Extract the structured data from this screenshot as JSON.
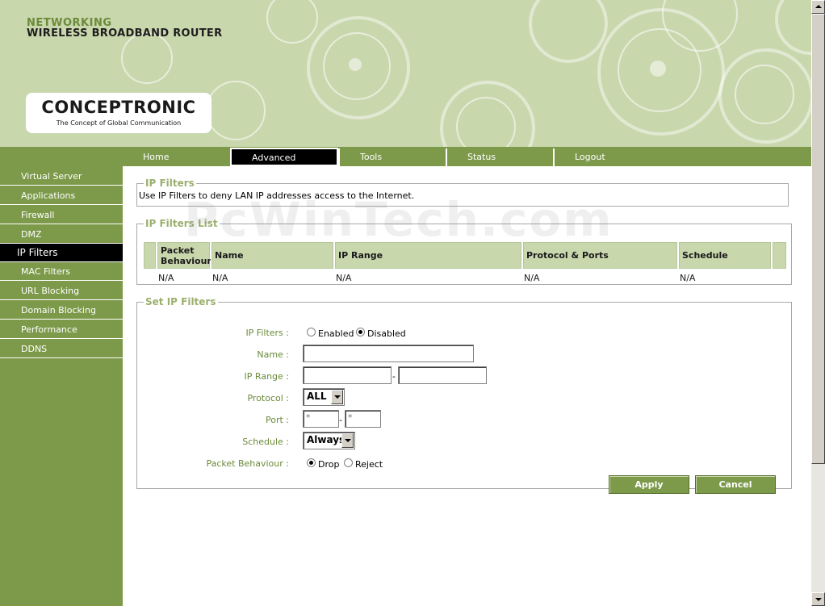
{
  "header": {
    "brand_line1": "NETWORKING",
    "brand_line2": "WIRELESS BROADBAND ROUTER",
    "logo_text": "CONCEPTRONIC",
    "logo_tagline": "The Concept of Global Communication"
  },
  "nav": {
    "tabs": [
      "Home",
      "Advanced",
      "Tools",
      "Status",
      "Logout"
    ],
    "active": "Advanced"
  },
  "sidebar": {
    "items": [
      "Virtual Server",
      "Applications",
      "Firewall",
      "DMZ",
      "IP Filters",
      "MAC Filters",
      "URL Blocking",
      "Domain Blocking",
      "Performance",
      "DDNS"
    ],
    "active": "IP Filters"
  },
  "ip_filters": {
    "title": "IP Filters",
    "description": "Use IP Filters to deny LAN IP addresses access to the Internet."
  },
  "list": {
    "title": "IP Filters List",
    "columns": [
      "Packet Behaviour",
      "Name",
      "IP Range",
      "Protocol & Ports",
      "Schedule"
    ],
    "rows": [
      [
        "N/A",
        "N/A",
        "N/A",
        "N/A",
        "N/A"
      ]
    ]
  },
  "form": {
    "title": "Set IP Filters",
    "labels": {
      "ip_filters": "IP Filters :",
      "name": "Name :",
      "ip_range": "IP Range :",
      "protocol": "Protocol :",
      "port": "Port :",
      "schedule": "Schedule :",
      "packet_behaviour": "Packet Behaviour :"
    },
    "enabled_label": "Enabled",
    "disabled_label": "Disabled",
    "ip_filters_state": "Disabled",
    "name_value": "",
    "ip_range_start": "",
    "ip_range_end": "",
    "separator": "-",
    "protocol_value": "ALL",
    "port_start": "*",
    "port_end": "*",
    "schedule_value": "Always",
    "drop_label": "Drop",
    "reject_label": "Reject",
    "packet_behaviour_state": "Drop",
    "apply_label": "Apply",
    "cancel_label": "Cancel"
  },
  "watermark": "PcWinTech.com",
  "colors": {
    "header_bg": "#c9d7ad",
    "accent_green": "#7c9a4a",
    "legend_green": "#9bb06e",
    "label_green": "#6b8a3a",
    "active_bg": "#000000"
  }
}
